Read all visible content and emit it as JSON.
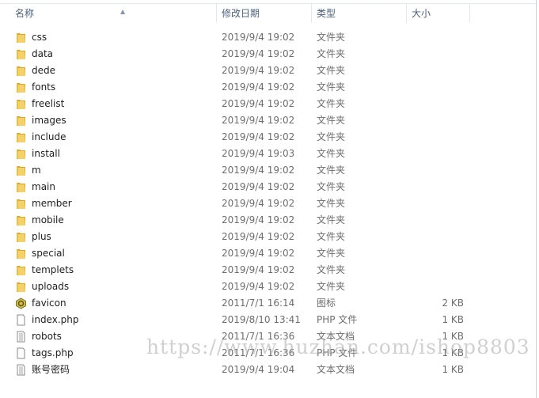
{
  "columns": {
    "name": "名称",
    "date": "修改日期",
    "type": "类型",
    "size": "大小"
  },
  "files": [
    {
      "name": "css",
      "date": "2019/9/4 19:02",
      "type": "文件夹",
      "size": "",
      "icon": "folder"
    },
    {
      "name": "data",
      "date": "2019/9/4 19:02",
      "type": "文件夹",
      "size": "",
      "icon": "folder"
    },
    {
      "name": "dede",
      "date": "2019/9/4 19:02",
      "type": "文件夹",
      "size": "",
      "icon": "folder"
    },
    {
      "name": "fonts",
      "date": "2019/9/4 19:02",
      "type": "文件夹",
      "size": "",
      "icon": "folder"
    },
    {
      "name": "freelist",
      "date": "2019/9/4 19:02",
      "type": "文件夹",
      "size": "",
      "icon": "folder"
    },
    {
      "name": "images",
      "date": "2019/9/4 19:02",
      "type": "文件夹",
      "size": "",
      "icon": "folder"
    },
    {
      "name": "include",
      "date": "2019/9/4 19:02",
      "type": "文件夹",
      "size": "",
      "icon": "folder"
    },
    {
      "name": "install",
      "date": "2019/9/4 19:03",
      "type": "文件夹",
      "size": "",
      "icon": "folder"
    },
    {
      "name": "m",
      "date": "2019/9/4 19:02",
      "type": "文件夹",
      "size": "",
      "icon": "folder"
    },
    {
      "name": "main",
      "date": "2019/9/4 19:02",
      "type": "文件夹",
      "size": "",
      "icon": "folder"
    },
    {
      "name": "member",
      "date": "2019/9/4 19:02",
      "type": "文件夹",
      "size": "",
      "icon": "folder"
    },
    {
      "name": "mobile",
      "date": "2019/9/4 19:02",
      "type": "文件夹",
      "size": "",
      "icon": "folder"
    },
    {
      "name": "plus",
      "date": "2019/9/4 19:02",
      "type": "文件夹",
      "size": "",
      "icon": "folder"
    },
    {
      "name": "special",
      "date": "2019/9/4 19:02",
      "type": "文件夹",
      "size": "",
      "icon": "folder"
    },
    {
      "name": "templets",
      "date": "2019/9/4 19:02",
      "type": "文件夹",
      "size": "",
      "icon": "folder"
    },
    {
      "name": "uploads",
      "date": "2019/9/4 19:02",
      "type": "文件夹",
      "size": "",
      "icon": "folder"
    },
    {
      "name": "favicon",
      "date": "2011/7/1 16:14",
      "type": "图标",
      "size": "2 KB",
      "icon": "favicon"
    },
    {
      "name": "index.php",
      "date": "2019/8/10 13:41",
      "type": "PHP 文件",
      "size": "1 KB",
      "icon": "file"
    },
    {
      "name": "robots",
      "date": "2011/7/1 16:36",
      "type": "文本文档",
      "size": "1 KB",
      "icon": "text"
    },
    {
      "name": "tags.php",
      "date": "2011/7/1 16:36",
      "type": "PHP 文件",
      "size": "1 KB",
      "icon": "file"
    },
    {
      "name": "账号密码",
      "date": "2019/9/4 19:04",
      "type": "文本文档",
      "size": "1 KB",
      "icon": "text"
    }
  ],
  "watermark": "https://www.huzhan.com/ishop8803"
}
